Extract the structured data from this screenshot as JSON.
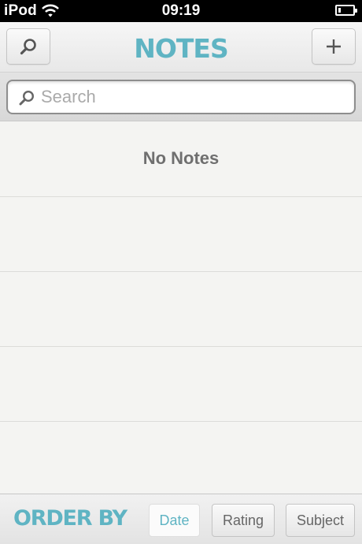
{
  "status_bar": {
    "device": "iPod",
    "time": "09:19",
    "battery_percent": 20
  },
  "nav": {
    "title": "NOTES",
    "search_icon": "magnifier-icon",
    "add_icon": "plus-icon"
  },
  "search": {
    "placeholder": "Search",
    "value": ""
  },
  "notes": {
    "empty_message": "No Notes"
  },
  "footer": {
    "label": "ORDER BY",
    "options": [
      "Date",
      "Rating",
      "Subject"
    ],
    "selected": "Date"
  },
  "colors": {
    "accent": "#5fb4c3",
    "background": "#f4f4f2"
  }
}
